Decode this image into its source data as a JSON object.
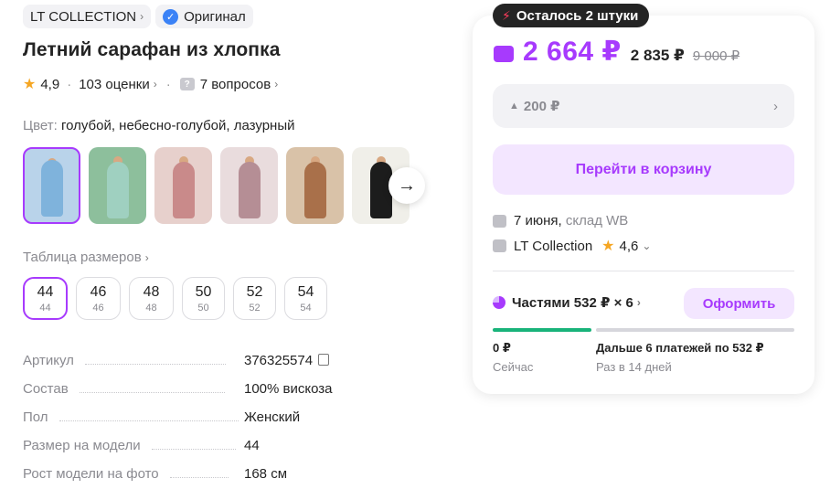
{
  "chips": {
    "brand": "LT COLLECTION",
    "original": "Оригинал"
  },
  "title": "Летний сарафан из хлопка",
  "rating": {
    "score": "4,9",
    "reviews": "103 оценки",
    "questions": "7 вопросов"
  },
  "color": {
    "label": "Цвет:",
    "value": "голубой, небесно-голубой, лазурный"
  },
  "thumbnails": [
    {
      "bg": "#b9d3ea",
      "dress": "#7fb3dc"
    },
    {
      "bg": "#8dbf9c",
      "dress": "#9fd0c0"
    },
    {
      "bg": "#e7d0cc",
      "dress": "#c98a8a"
    },
    {
      "bg": "#e9dcdd",
      "dress": "#b58e95"
    },
    {
      "bg": "#d9c2a8",
      "dress": "#a9704a"
    },
    {
      "bg": "#f0efe9",
      "dress": "#1c1c1c"
    }
  ],
  "sizes": {
    "title": "Таблица размеров",
    "items": [
      {
        "size": "44",
        "ru": "44"
      },
      {
        "size": "46",
        "ru": "46"
      },
      {
        "size": "48",
        "ru": "48"
      },
      {
        "size": "50",
        "ru": "50"
      },
      {
        "size": "52",
        "ru": "52"
      },
      {
        "size": "54",
        "ru": "54"
      }
    ]
  },
  "specs": [
    {
      "key": "Артикул",
      "value": "376325574"
    },
    {
      "key": "Состав",
      "value": "100% вискоза"
    },
    {
      "key": "Пол",
      "value": "Женский"
    },
    {
      "key": "Размер на модели",
      "value": "44"
    },
    {
      "key": "Рост модели на фото",
      "value": "168 см"
    }
  ],
  "card": {
    "stock_badge": "Осталось 2 штуки",
    "price_main": "2 664 ₽",
    "price_mid": "2 835 ₽",
    "price_old": "9 000 ₽",
    "promo": "200 ₽",
    "cart_button": "Перейти в корзину",
    "delivery_date": "7 июня,",
    "delivery_store": "склад WB",
    "seller": "LT Collection",
    "seller_rating": "4,6",
    "installments": "Частями 532 ₽ × 6",
    "issue_button": "Оформить",
    "pay_now_amount": "0 ₽",
    "pay_now_label": "Сейчас",
    "pay_next_amount": "Дальше 6 платежей по 532 ₽",
    "pay_next_label": "Раз в 14 дней"
  },
  "colors": {
    "accent": "#a73afd",
    "accent_light": "#f3e6ff",
    "success": "#19b37a"
  }
}
